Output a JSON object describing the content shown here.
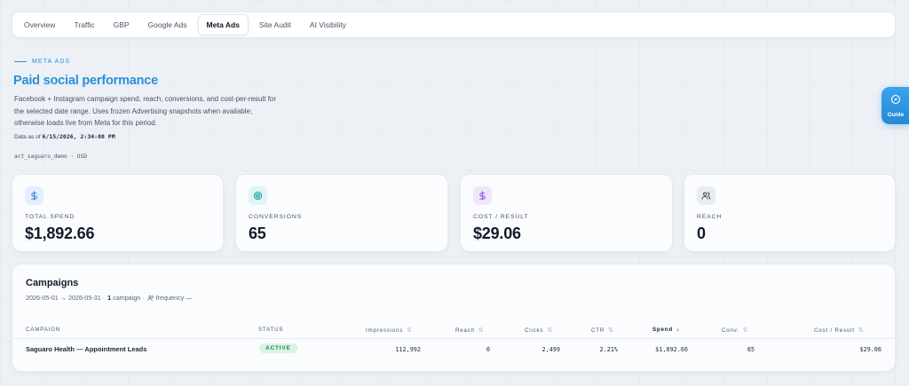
{
  "tabs": [
    {
      "label": "Overview",
      "active": false
    },
    {
      "label": "Traffic",
      "active": false
    },
    {
      "label": "GBP",
      "active": false
    },
    {
      "label": "Google Ads",
      "active": false
    },
    {
      "label": "Meta Ads",
      "active": true
    },
    {
      "label": "Site Audit",
      "active": false
    },
    {
      "label": "AI Visibility",
      "active": false
    }
  ],
  "header": {
    "eyebrow": "META ADS",
    "title": "Paid social performance",
    "description": "Facebook + Instagram campaign spend, reach, conversions, and cost-per-result for the selected date range. Uses frozen Advertising snapshots when available; otherwise loads live from Meta for this period.",
    "data_as_of_label": "Data as of",
    "data_as_of_value": "6/15/2026, 2:34:08 PM",
    "account": "act_saguaro_demo · USD"
  },
  "guide": {
    "label": "Guide",
    "icon": "compass-icon"
  },
  "kpis": [
    {
      "label": "TOTAL SPEND",
      "value": "$1,892.66",
      "icon": "dollar-icon",
      "color": "#2f7fd6",
      "bg": "#e3efff"
    },
    {
      "label": "CONVERSIONS",
      "value": "65",
      "icon": "target-icon",
      "color": "#17a2a6",
      "bg": "#dff5f4"
    },
    {
      "label": "COST / RESULT",
      "value": "$29.06",
      "icon": "dollar-icon",
      "color": "#8a55d9",
      "bg": "#efe6fc"
    },
    {
      "label": "REACH",
      "value": "0",
      "icon": "users-icon",
      "color": "#3b4452",
      "bg": "#e9ecf0"
    }
  ],
  "campaigns": {
    "title": "Campaigns",
    "date_range": "2026-05-01 → 2026-05-31 ·",
    "campaign_count": "1",
    "campaign_label": "campaign ·",
    "frequency_label": "frequency —",
    "columns": [
      {
        "label": "CAMPAIGN",
        "sortable": false,
        "active": false
      },
      {
        "label": "STATUS",
        "sortable": false,
        "active": false
      },
      {
        "label": "Impressions",
        "sortable": true,
        "active": false
      },
      {
        "label": "Reach",
        "sortable": true,
        "active": false
      },
      {
        "label": "Clicks",
        "sortable": true,
        "active": false
      },
      {
        "label": "CTR",
        "sortable": true,
        "active": false
      },
      {
        "label": "Spend",
        "sortable": true,
        "active": true
      },
      {
        "label": "Conv.",
        "sortable": true,
        "active": false
      },
      {
        "label": "Cost / Result",
        "sortable": true,
        "active": false
      }
    ],
    "rows": [
      {
        "name": "Saguaro Health — Appointment Leads",
        "status": "ACTIVE",
        "impressions": "112,992",
        "reach": "0",
        "clicks": "2,499",
        "ctr": "2.21%",
        "spend": "$1,892.66",
        "conversions": "65",
        "cost_per_result": "$29.06"
      }
    ]
  }
}
